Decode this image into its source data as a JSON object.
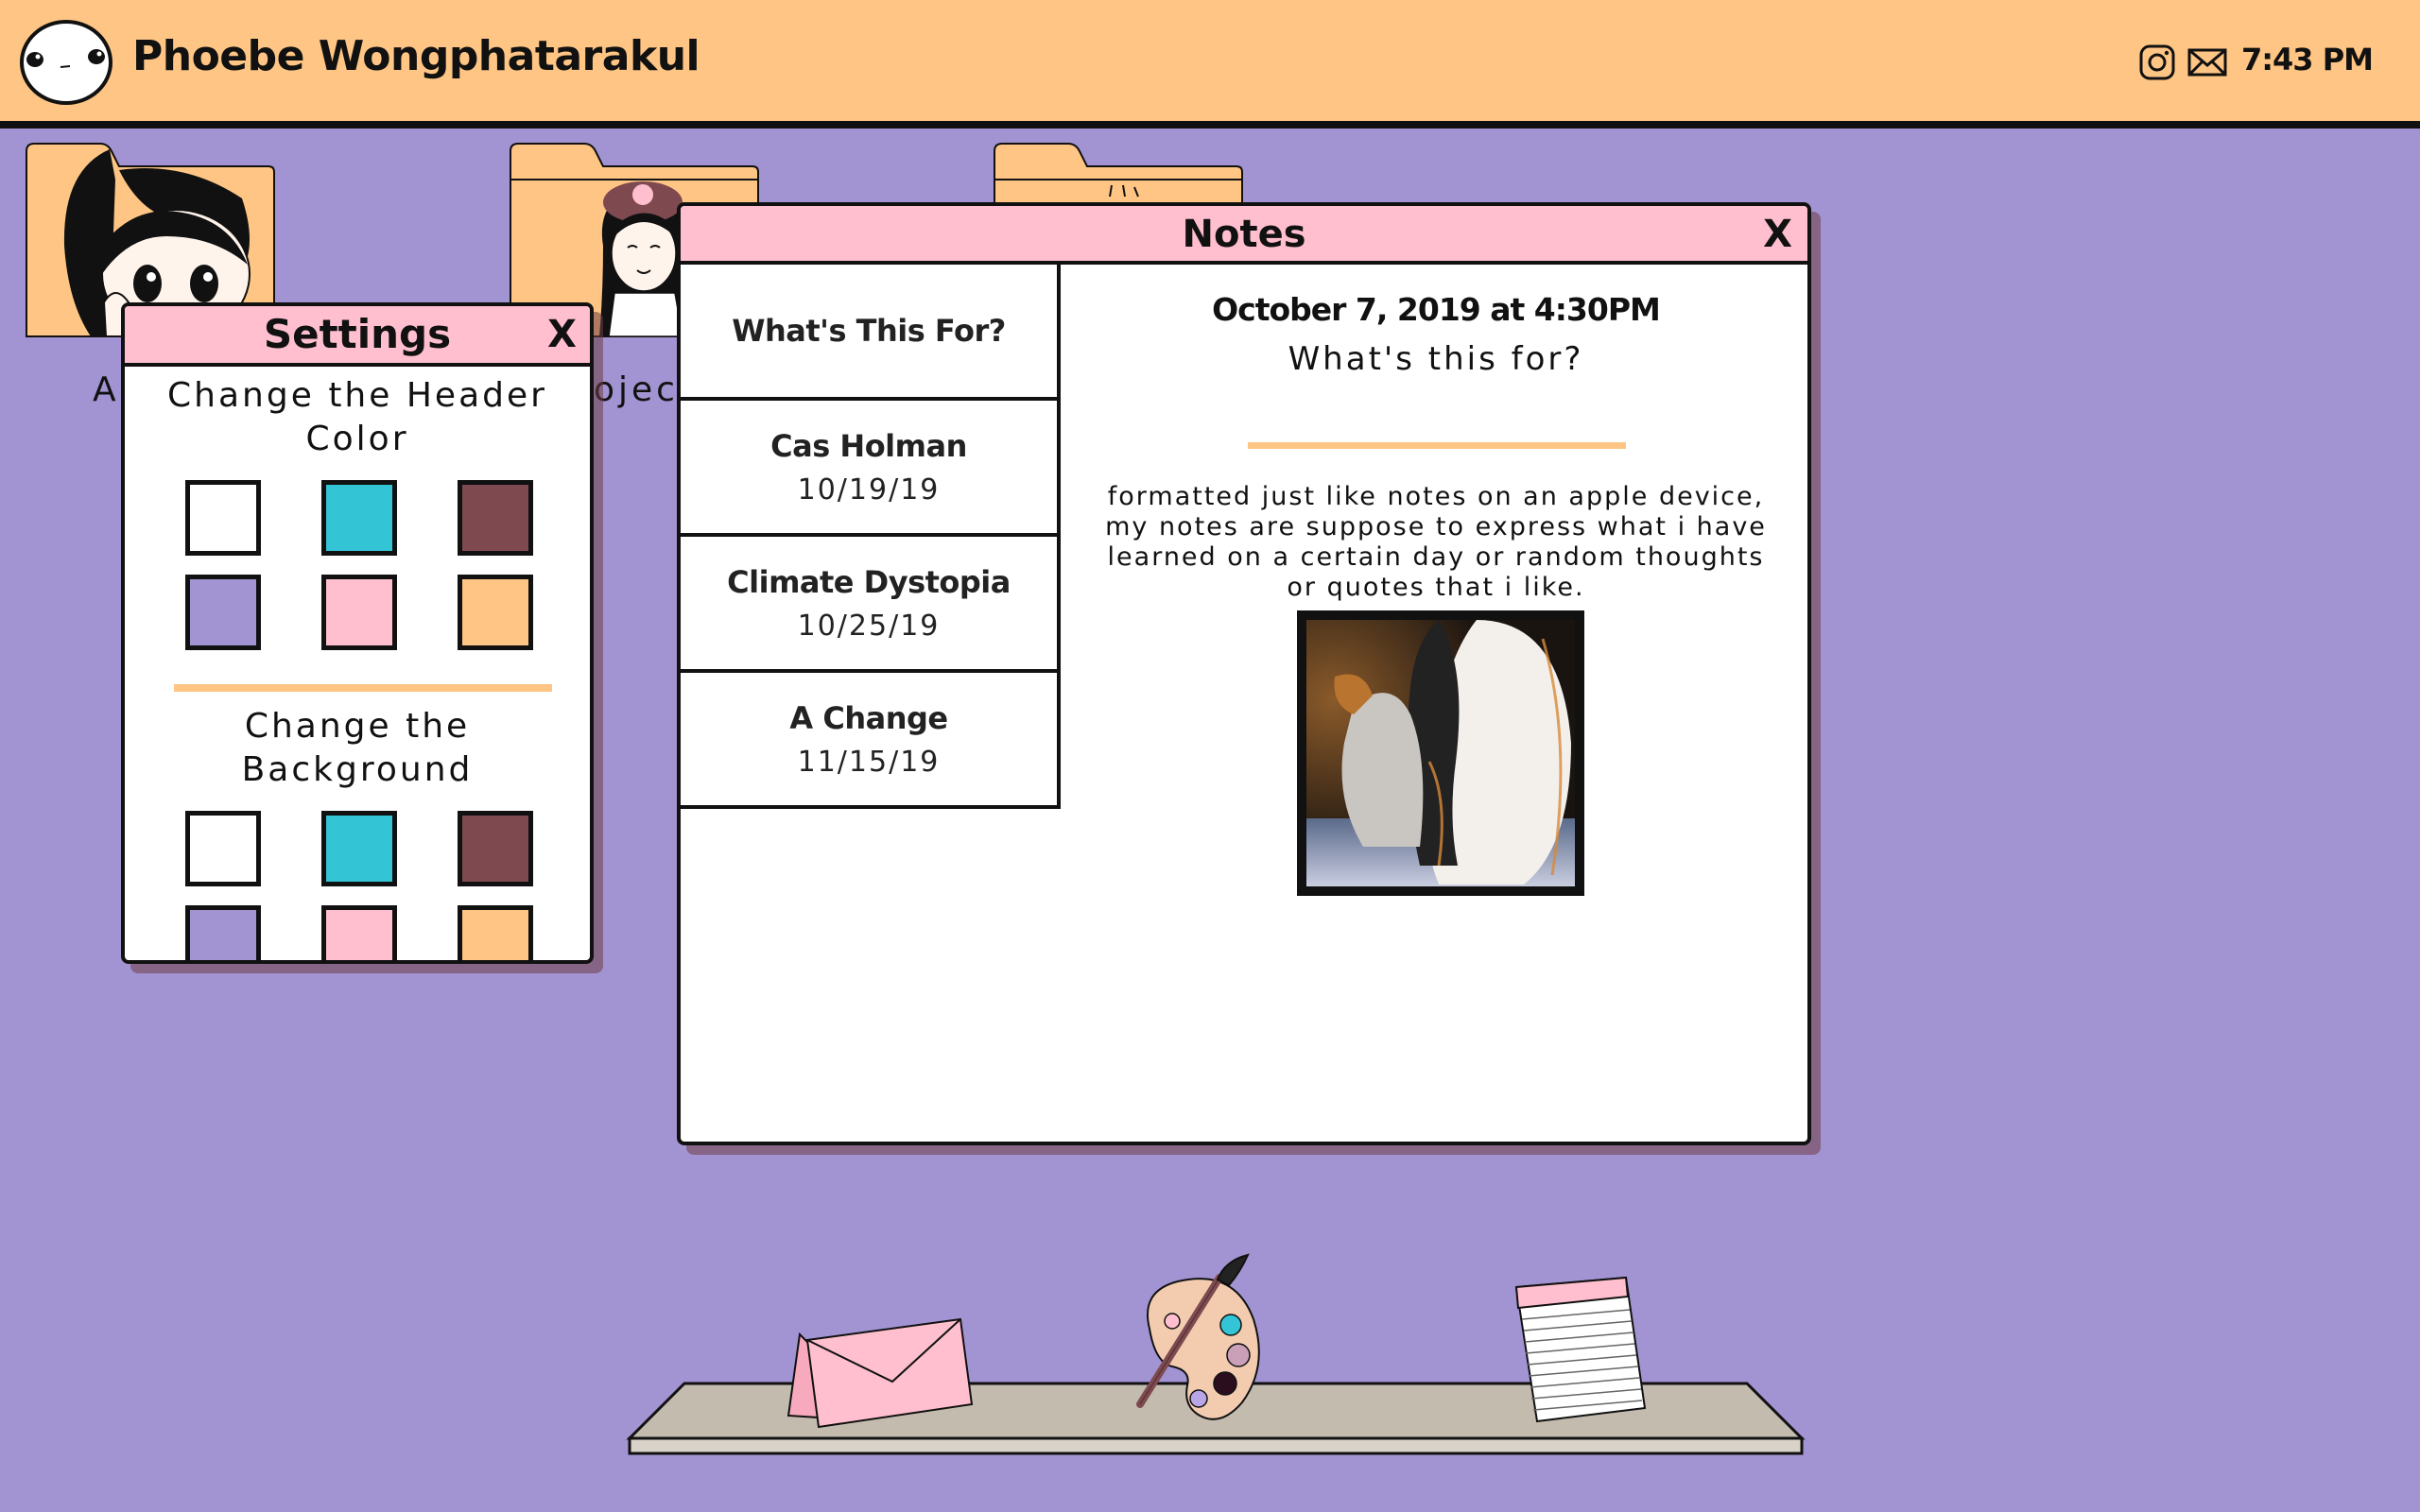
{
  "header": {
    "title": "Phoebe Wongphatarakul",
    "time": "7:43 PM",
    "icons": [
      "instagram-icon",
      "mail-icon"
    ]
  },
  "desktop": {
    "folders": [
      {
        "label": "A"
      },
      {
        "label": "ojec"
      },
      {
        "label": ""
      }
    ]
  },
  "settings": {
    "title": "Settings",
    "close": "X",
    "header_heading_line1": "Change the Header",
    "header_heading_line2": "Color",
    "background_heading_line1": "Change the",
    "background_heading_line2": "Background",
    "colors": [
      "#ffffff",
      "#33c5d6",
      "#7e4a4f",
      "#a294d2",
      "#ffbfcf",
      "#fec584"
    ]
  },
  "notes": {
    "title": "Notes",
    "close": "X",
    "items": [
      {
        "title": "What's This For?",
        "date": ""
      },
      {
        "title": "Cas Holman",
        "date": "10/19/19"
      },
      {
        "title": "Climate Dystopia",
        "date": "10/25/19"
      },
      {
        "title": "A Change",
        "date": "11/15/19"
      }
    ],
    "active": {
      "date": "October 7, 2019 at 4:30PM",
      "title": "What's this for?",
      "body_line1": "formatted just like notes on an apple device,",
      "body_line2": "my notes are suppose to express what i have",
      "body_line3": "learned on a certain day or random thoughts",
      "body_line4": "or quotes that i like."
    }
  },
  "theme": {
    "header_color": "#fec584",
    "background_color": "#a294d2",
    "window_bar_color": "#ffbfcf"
  }
}
